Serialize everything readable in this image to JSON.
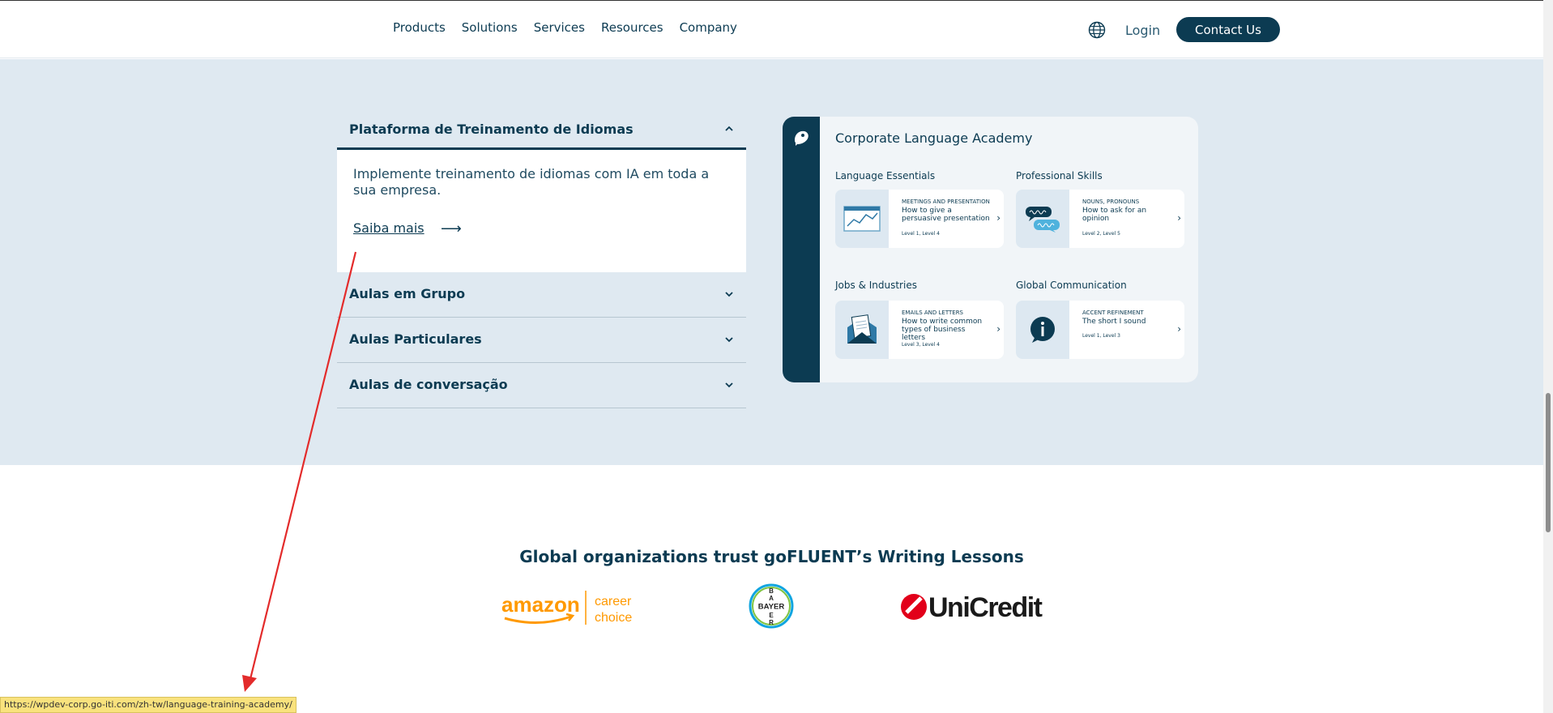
{
  "header": {
    "nav": [
      "Products",
      "Solutions",
      "Services",
      "Resources",
      "Company"
    ],
    "login": "Login",
    "contact": "Contact Us"
  },
  "accordion": {
    "open_title": "Plataforma de Treinamento de Idiomas",
    "open_desc": "Implemente treinamento de idiomas com IA em toda a sua empresa.",
    "open_link": "Saiba mais",
    "open_arrow": "⟶",
    "items": [
      "Aulas em Grupo",
      "Aulas Particulares",
      "Aulas de conversação"
    ]
  },
  "card": {
    "title": "Corporate Language Academy",
    "categories": [
      {
        "label": "Language Essentials",
        "kicker": "MEETINGS AND PRESENTATION",
        "title": "How to give a persuasive presentation",
        "level": "Level 1, Level 4",
        "icon": "chart-board-icon"
      },
      {
        "label": "Professional Skills",
        "kicker": "NOUNS, PRONOUNS",
        "title": "How to ask for an opinion",
        "level": "Level 2, Level 5",
        "icon": "speech-bubbles-icon"
      },
      {
        "label": "Jobs & Industries",
        "kicker": "EMAILS AND LETTERS",
        "title": "How to write common types of business letters",
        "level": "Level 3, Level 4",
        "icon": "envelope-letter-icon"
      },
      {
        "label": "Global Communication",
        "kicker": "ACCENT REFINEMENT",
        "title": "The short I sound",
        "level": "Level 1, Level 3",
        "icon": "letter-i-bubble-icon"
      }
    ]
  },
  "trust": {
    "title": "Global organizations trust goFLUENT’s Writing Lessons",
    "logos": {
      "amazon_word": "amazon",
      "amazon_line1": "career",
      "amazon_line2": "choice",
      "bayer": "BAYER",
      "unicredit": "UniCredit"
    }
  },
  "status": {
    "url": "https://wpdev-corp.go-iti.com/zh-tw/language-training-academy/"
  },
  "colors": {
    "brand_dark": "#0c3b52",
    "section_bg": "#dfe9f1",
    "amazon_orange": "#ff9900",
    "unicredit_red": "#e2001a",
    "annotation_red": "#e32b2b"
  }
}
